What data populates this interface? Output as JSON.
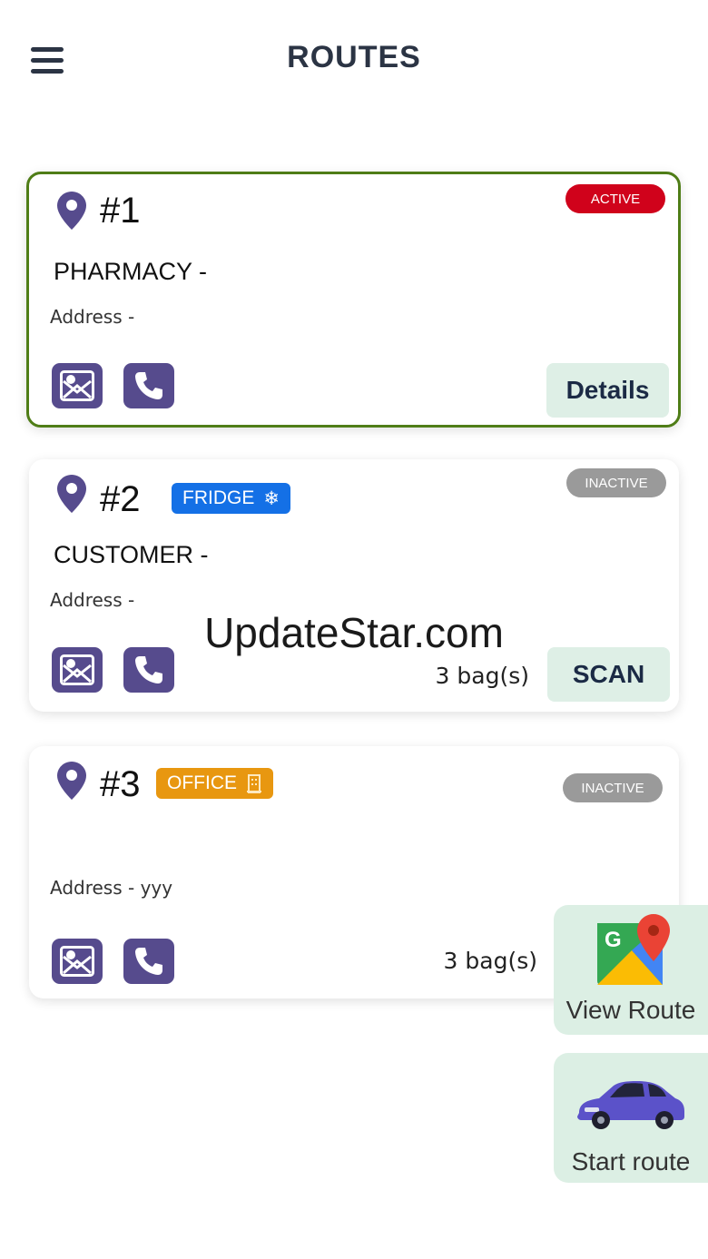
{
  "header": {
    "title": "ROUTES",
    "menu_icon": "hamburger-menu-icon"
  },
  "watermark": "UpdateStar.com",
  "colors": {
    "active_border": "#4f7d17",
    "active_badge": "#d0021b",
    "inactive_badge": "#9a9a9a",
    "fridge_tag": "#1470e6",
    "office_tag": "#e89710",
    "icon_button": "#564b8d",
    "action_button": "#deefe6"
  },
  "routes": [
    {
      "number": "#1",
      "status": "ACTIVE",
      "name": "PHARMACY -",
      "address": "Address -",
      "action": "Details"
    },
    {
      "number": "#2",
      "status": "INACTIVE",
      "tag": "FRIDGE",
      "tag_icon": "snowflake-icon",
      "name": "CUSTOMER -",
      "address": "Address -",
      "bags": "3 bag(s)",
      "action": "SCAN"
    },
    {
      "number": "#3",
      "status": "INACTIVE",
      "tag": "OFFICE",
      "tag_icon": "building-icon",
      "address": "Address - yyy",
      "bags": "3 bag(s)"
    }
  ],
  "fabs": {
    "view_route": {
      "label": "View Route",
      "icon": "google-maps-icon"
    },
    "start_route": {
      "label": "Start route",
      "icon": "car-icon"
    }
  }
}
